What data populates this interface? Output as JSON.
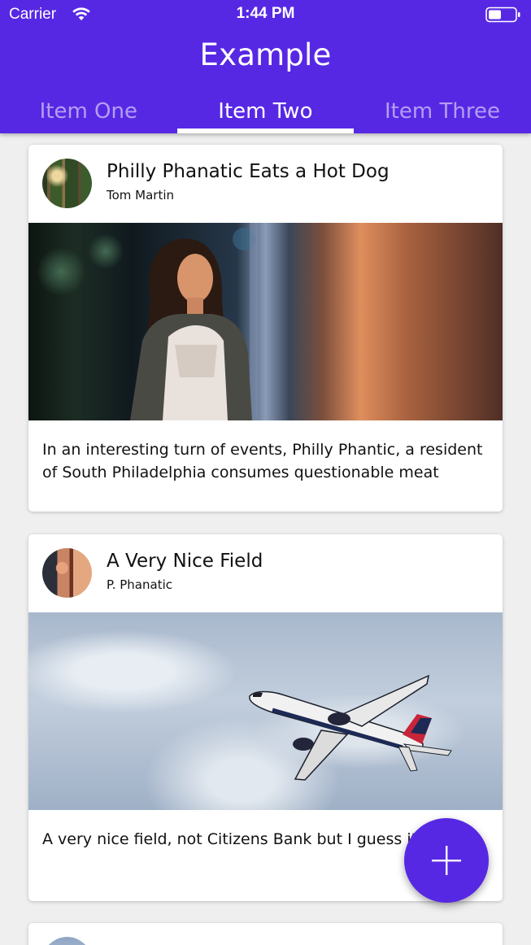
{
  "status_bar": {
    "carrier": "Carrier",
    "time": "1:44 PM"
  },
  "header": {
    "title": "Example",
    "tabs": [
      {
        "label": "Item One",
        "active": false
      },
      {
        "label": "Item Two",
        "active": true
      },
      {
        "label": "Item Three",
        "active": false
      }
    ]
  },
  "cards": [
    {
      "title": "Philly Phanatic Eats a Hot Dog",
      "author": "Tom Martin",
      "text": "In an interesting turn of events, Philly Phantic, a resident of South Philadelphia consumes questionable meat"
    },
    {
      "title": "A Very Nice Field",
      "author": "P. Phanatic",
      "text": "A very nice field, not Citizens Bank but I guess it"
    }
  ],
  "fab": {
    "icon": "plus-icon"
  },
  "colors": {
    "primary": "#5728e4",
    "background": "#efefef",
    "card": "#ffffff"
  }
}
